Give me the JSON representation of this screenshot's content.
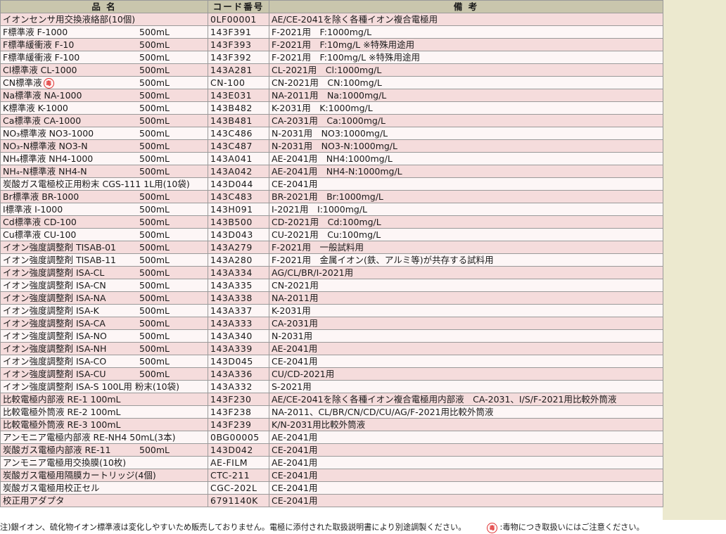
{
  "columns": {
    "name": "品 名",
    "code": "コード番号",
    "note": "備 考"
  },
  "rows": [
    {
      "name": "イオンセンサ用交換液絡部(10個)",
      "vol": "",
      "code": "0LF00001",
      "note": "AE/CE-2041を除く各種イオン複合電極用"
    },
    {
      "name": "F標準液 F-1000",
      "vol": "500mL",
      "code": "143F391",
      "note": "F-2021用　F:1000mg/L"
    },
    {
      "name": "F標準緩衝液 F-10",
      "vol": "500mL",
      "code": "143F393",
      "note": "F-2021用　F:10mg/L ※特殊用途用"
    },
    {
      "name": "F標準緩衝液 F-100",
      "vol": "500mL",
      "code": "143F392",
      "note": "F-2021用　F:100mg/L ※特殊用途用"
    },
    {
      "name": "Cl標準液 CL-1000",
      "vol": "500mL",
      "code": "143A281",
      "note": "CL-2021用　Cl:1000mg/L"
    },
    {
      "name": "CN標準液",
      "vol": "500mL",
      "code": "CN-100",
      "note": "CN-2021用　CN:100mg/L",
      "poison": true
    },
    {
      "name": "Na標準液 NA-1000",
      "vol": "500mL",
      "code": "143E031",
      "note": "NA-2011用　Na:1000mg/L"
    },
    {
      "name": "K標準液 K-1000",
      "vol": "500mL",
      "code": "143B482",
      "note": "K-2031用　K:1000mg/L"
    },
    {
      "name": "Ca標準液 CA-1000",
      "vol": "500mL",
      "code": "143B481",
      "note": "CA-2031用　Ca:1000mg/L"
    },
    {
      "name": "NO₃標準液 NO3-1000",
      "vol": "500mL",
      "code": "143C486",
      "note": "N-2031用　NO3:1000mg/L"
    },
    {
      "name": "NO₃-N標準液 NO3-N",
      "vol": "500mL",
      "code": "143C487",
      "note": "N-2031用　NO3-N:1000mg/L"
    },
    {
      "name": "NH₄標準液 NH4-1000",
      "vol": "500mL",
      "code": "143A041",
      "note": "AE-2041用　NH4:1000mg/L"
    },
    {
      "name": "NH₄-N標準液 NH4-N",
      "vol": "500mL",
      "code": "143A042",
      "note": "AE-2041用　NH4-N:1000mg/L"
    },
    {
      "name": "炭酸ガス電極校正用粉末 CGS-111 1L用(10袋)",
      "vol": "",
      "code": "143D044",
      "note": "CE-2041用"
    },
    {
      "name": "Br標準液 BR-1000",
      "vol": "500mL",
      "code": "143C483",
      "note": "BR-2021用　Br:1000mg/L"
    },
    {
      "name": "I標準液 I-1000",
      "vol": "500mL",
      "code": "143H091",
      "note": "I-2021用　I:1000mg/L"
    },
    {
      "name": "Cd標準液 CD-100",
      "vol": "500mL",
      "code": "143B500",
      "note": "CD-2021用　Cd:100mg/L"
    },
    {
      "name": "Cu標準液 CU-100",
      "vol": "500mL",
      "code": "143D043",
      "note": "CU-2021用　Cu:100mg/L"
    },
    {
      "name": "イオン強度調整剤 TISAB-01",
      "vol": "500mL",
      "code": "143A279",
      "note": "F-2021用　一般試料用"
    },
    {
      "name": "イオン強度調整剤 TISAB-11",
      "vol": "500mL",
      "code": "143A280",
      "note": "F-2021用　金属イオン(鉄、アルミ等)が共存する試料用"
    },
    {
      "name": "イオン強度調整剤 ISA-CL",
      "vol": "500mL",
      "code": "143A334",
      "note": "AG/CL/BR/I-2021用"
    },
    {
      "name": "イオン強度調整剤 ISA-CN",
      "vol": "500mL",
      "code": "143A335",
      "note": "CN-2021用"
    },
    {
      "name": "イオン強度調整剤 ISA-NA",
      "vol": "500mL",
      "code": "143A338",
      "note": "NA-2011用"
    },
    {
      "name": "イオン強度調整剤 ISA-K",
      "vol": "500mL",
      "code": "143A337",
      "note": "K-2031用"
    },
    {
      "name": "イオン強度調整剤 ISA-CA",
      "vol": "500mL",
      "code": "143A333",
      "note": "CA-2031用"
    },
    {
      "name": "イオン強度調整剤 ISA-NO",
      "vol": "500mL",
      "code": "143A340",
      "note": "N-2031用"
    },
    {
      "name": "イオン強度調整剤 ISA-NH",
      "vol": "500mL",
      "code": "143A339",
      "note": "AE-2041用"
    },
    {
      "name": "イオン強度調整剤 ISA-CO",
      "vol": "500mL",
      "code": "143D045",
      "note": "CE-2041用"
    },
    {
      "name": "イオン強度調整剤 ISA-CU",
      "vol": "500mL",
      "code": "143A336",
      "note": "CU/CD-2021用"
    },
    {
      "name": "イオン強度調整剤 ISA-S 100L用 粉末(10袋)",
      "vol": "",
      "code": "143A332",
      "note": "S-2021用"
    },
    {
      "name": "比較電極内部液 RE-1 100mL",
      "vol": "",
      "code": "143F230",
      "note": "AE/CE-2041を除く各種イオン複合電極用内部液　CA-2031、I/S/F-2021用比較外筒液"
    },
    {
      "name": "比較電極外筒液 RE-2 100mL",
      "vol": "",
      "code": "143F238",
      "note": "NA-2011、CL/BR/CN/CD/CU/AG/F-2021用比較外筒液"
    },
    {
      "name": "比較電極外筒液 RE-3 100mL",
      "vol": "",
      "code": "143F239",
      "note": "K/N-2031用比較外筒液"
    },
    {
      "name": "アンモニア電極内部液 RE-NH4 50mL(3本)",
      "vol": "",
      "code": "0BG00005",
      "note": "AE-2041用"
    },
    {
      "name": "炭酸ガス電極内部液 RE-11",
      "vol": "500mL",
      "code": "143D042",
      "note": "CE-2041用"
    },
    {
      "name": "アンモニア電極用交換膜(10枚)",
      "vol": "",
      "code": "AE-FILM",
      "note": "AE-2041用"
    },
    {
      "name": "炭酸ガス電極用隔膜カートリッジ(4個)",
      "vol": "",
      "code": "CTC-211",
      "note": "CE-2041用"
    },
    {
      "name": "炭酸ガス電極用校正セル",
      "vol": "",
      "code": "CGC-202L",
      "note": "CE-2041用"
    },
    {
      "name": "校正用アダプタ",
      "vol": "",
      "code": "6791140K",
      "note": "CE-2041用"
    }
  ],
  "poison_symbol": "毒",
  "footnote": {
    "main": "注)銀イオン、硫化物イオン標準液は変化しやすいため販売しておりません。電極に添付された取扱説明書により別途調製ください。",
    "poison_note": ":毒物につき取扱いにはご注意ください。"
  },
  "colors": {
    "header": "#c9c6ad",
    "row_odd": "#f5dcdc",
    "row_even": "#fdf6f6",
    "side_panel": "#ece9cf",
    "poison": "#e03030"
  }
}
